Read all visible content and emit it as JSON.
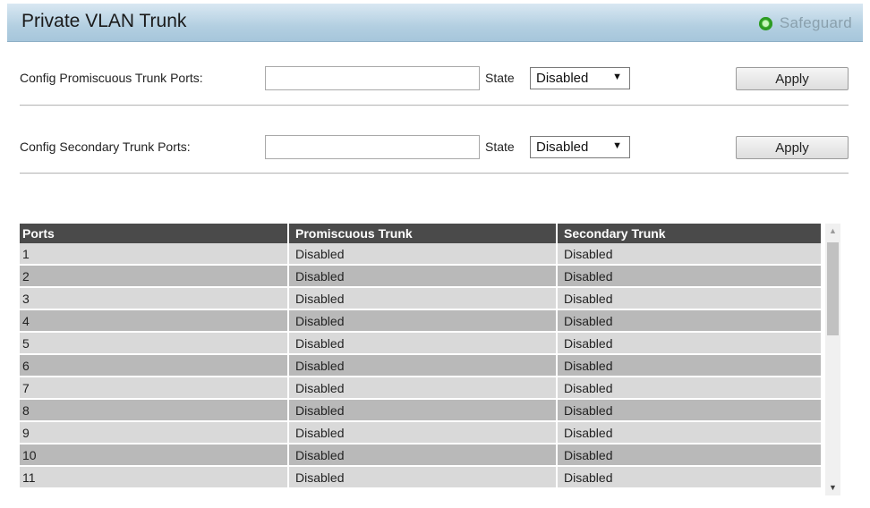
{
  "header": {
    "title": "Private VLAN Trunk",
    "safeguard_label": "Safeguard",
    "safeguard_status_color": "#2e9c24"
  },
  "promiscuous": {
    "label": "Config Promiscuous Trunk Ports:",
    "ports_value": "",
    "state_label": "State",
    "state_value": "Disabled",
    "apply_label": "Apply"
  },
  "secondary": {
    "label": "Config Secondary Trunk Ports:",
    "ports_value": "",
    "state_label": "State",
    "state_value": "Disabled",
    "apply_label": "Apply"
  },
  "table": {
    "headers": [
      "Ports",
      "Promiscuous Trunk",
      "Secondary Trunk"
    ],
    "rows": [
      [
        "1",
        "Disabled",
        "Disabled"
      ],
      [
        "2",
        "Disabled",
        "Disabled"
      ],
      [
        "3",
        "Disabled",
        "Disabled"
      ],
      [
        "4",
        "Disabled",
        "Disabled"
      ],
      [
        "5",
        "Disabled",
        "Disabled"
      ],
      [
        "6",
        "Disabled",
        "Disabled"
      ],
      [
        "7",
        "Disabled",
        "Disabled"
      ],
      [
        "8",
        "Disabled",
        "Disabled"
      ],
      [
        "9",
        "Disabled",
        "Disabled"
      ],
      [
        "10",
        "Disabled",
        "Disabled"
      ],
      [
        "11",
        "Disabled",
        "Disabled"
      ]
    ]
  },
  "icons": {
    "dropdown": "caret-down-icon",
    "scroll_up": "scroll-up-arrow-icon",
    "scroll_down": "scroll-down-arrow-icon",
    "status": "status-indicator-icon"
  }
}
